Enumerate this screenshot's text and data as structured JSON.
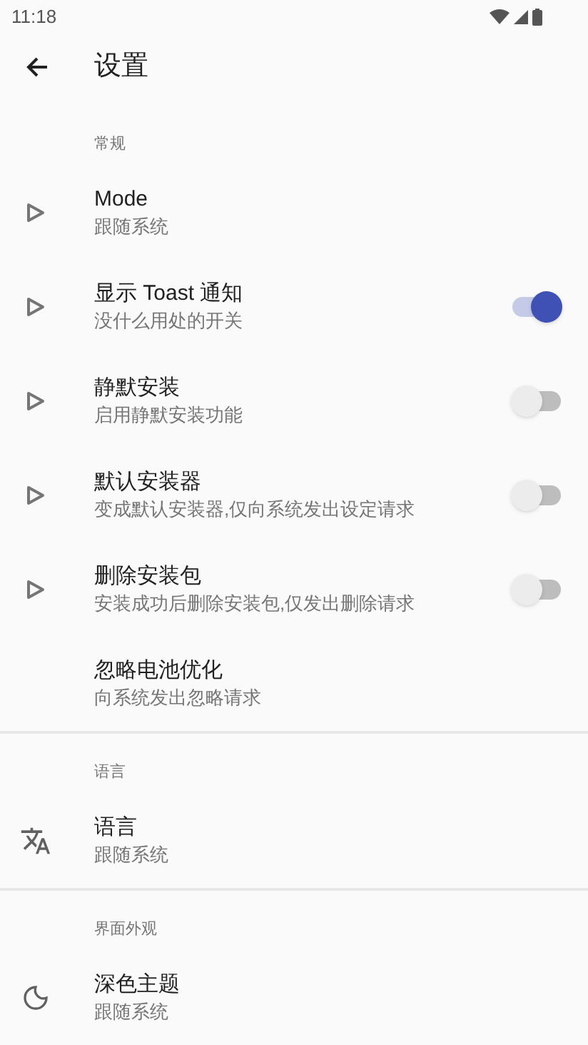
{
  "status_bar": {
    "time": "11:18"
  },
  "app_bar": {
    "title": "设置"
  },
  "sections": [
    {
      "header": "常规",
      "items": [
        {
          "kind": "plain",
          "title": "Mode",
          "summary": "跟随系统"
        },
        {
          "kind": "switch",
          "title": "显示 Toast 通知",
          "summary": "没什么用处的开关",
          "on": true
        },
        {
          "kind": "switch",
          "title": "静默安装",
          "summary": "启用静默安装功能",
          "on": false
        },
        {
          "kind": "switch",
          "title": "默认安装器",
          "summary": "变成默认安装器,仅向系统发出设定请求",
          "on": false
        },
        {
          "kind": "switch",
          "title": "删除安装包",
          "summary": "安装成功后删除安装包,仅发出删除请求",
          "on": false
        },
        {
          "kind": "plain",
          "title": "忽略电池优化",
          "summary": "向系统发出忽略请求"
        }
      ]
    },
    {
      "header": "语言",
      "items": [
        {
          "kind": "plain",
          "title": "语言",
          "summary": "跟随系统"
        }
      ]
    },
    {
      "header": "界面外观",
      "items": [
        {
          "kind": "plain",
          "title": "深色主题",
          "summary": "跟随系统"
        }
      ]
    }
  ]
}
